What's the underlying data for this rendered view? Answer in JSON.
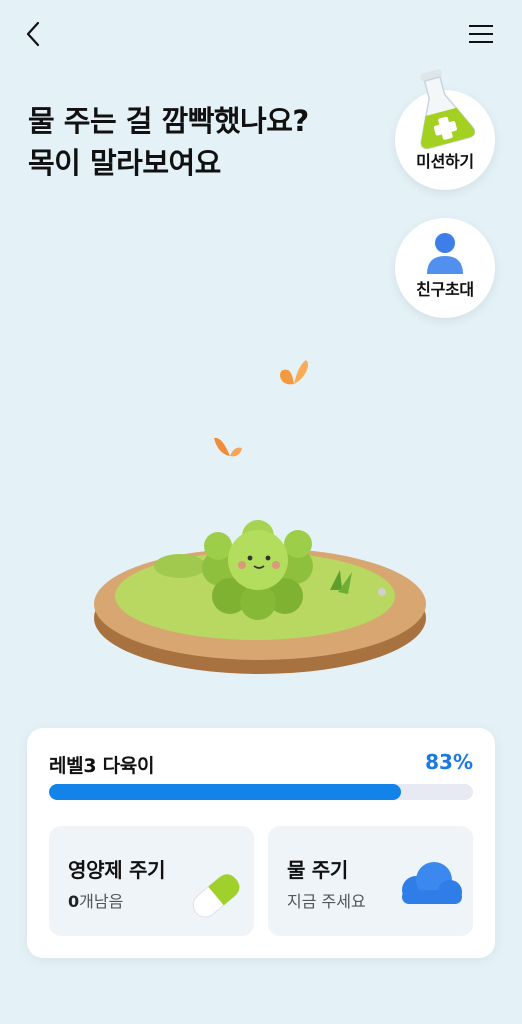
{
  "header": {
    "back_icon": "chevron-left-icon",
    "menu_icon": "hamburger-menu-icon"
  },
  "headline": {
    "line1": "물 주는 걸 깜빡했나요?",
    "line2": "목이 말라보여요"
  },
  "actions": {
    "mission_label": "미션하기",
    "mission_icon": "flask-icon",
    "invite_label": "친구초대",
    "invite_icon": "person-icon"
  },
  "plant": {
    "name_icon": "succulent-character-icon"
  },
  "status": {
    "level_label": "레벨3 다육이",
    "progress_text": "83%",
    "progress_value": 83,
    "accent_color": "#1383ea"
  },
  "nutrient": {
    "title": "영양제 주기",
    "count": "0",
    "count_suffix": "개남음",
    "icon": "pill-capsule-icon"
  },
  "water": {
    "title": "물 주기",
    "subtitle": "지금 주세요",
    "icon": "cloud-icon"
  }
}
